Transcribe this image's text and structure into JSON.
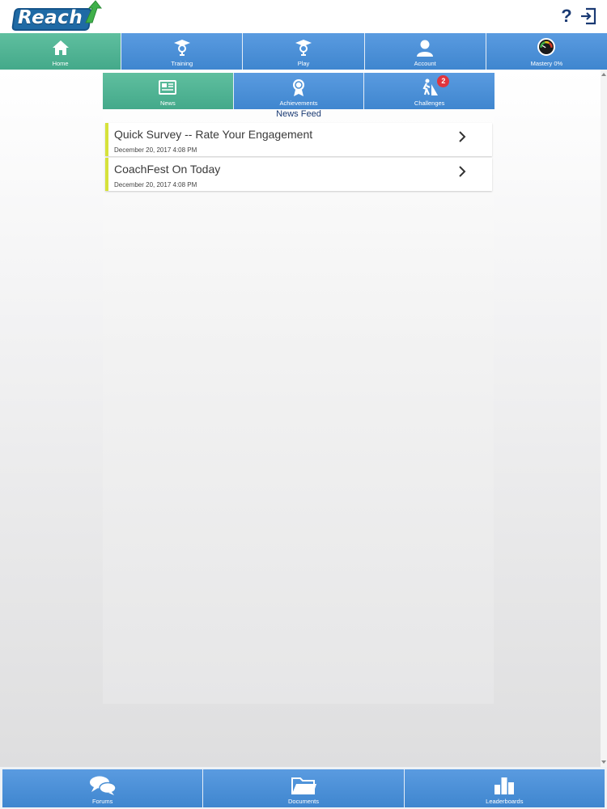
{
  "header": {
    "logo_text": "Reach",
    "help_glyph": "?"
  },
  "topnav": {
    "tabs": [
      {
        "label": "Home",
        "icon": "home-icon",
        "active": true
      },
      {
        "label": "Training",
        "icon": "training-icon",
        "active": false
      },
      {
        "label": "Play",
        "icon": "play-icon",
        "active": false
      },
      {
        "label": "Account",
        "icon": "account-icon",
        "active": false
      },
      {
        "label": "Mastery 0%",
        "icon": "mastery-gauge-icon",
        "active": false
      }
    ]
  },
  "subnav": {
    "tabs": [
      {
        "label": "News",
        "icon": "news-icon",
        "active": true
      },
      {
        "label": "Achievements",
        "icon": "achievements-icon",
        "active": false
      },
      {
        "label": "Challenges",
        "icon": "challenges-icon",
        "active": false,
        "badge": "2"
      }
    ]
  },
  "feed": {
    "title": "News Feed",
    "items": [
      {
        "title": "Quick Survey -- Rate Your Engagement",
        "date": "December 20, 2017 4:08 PM"
      },
      {
        "title": "CoachFest On Today",
        "date": "December 20, 2017 4:08 PM"
      }
    ]
  },
  "bottomnav": {
    "tabs": [
      {
        "label": "Forums",
        "icon": "forums-icon"
      },
      {
        "label": "Documents",
        "icon": "documents-icon"
      },
      {
        "label": "Leaderboards",
        "icon": "leaderboards-icon"
      }
    ]
  },
  "colors": {
    "nav_blue": "#4a8fd4",
    "nav_active_green": "#4fb392",
    "news_accent": "#d6e23a",
    "badge_red": "#e0353d",
    "title_navy": "#1a3a73"
  }
}
